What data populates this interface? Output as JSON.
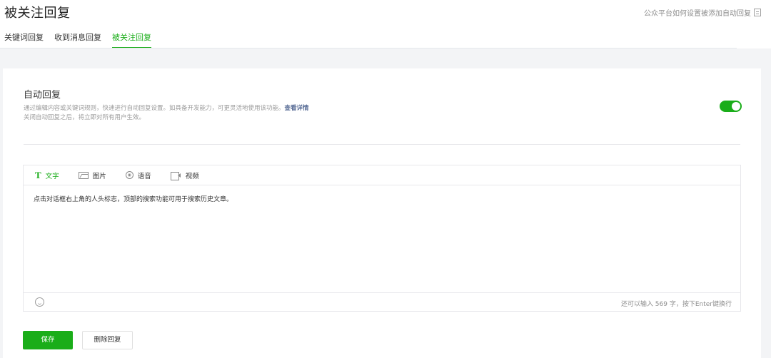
{
  "header": {
    "title": "被关注回复",
    "help_link": "公众平台如何设置被添加自动回复"
  },
  "tabs": [
    {
      "label": "关键词回复",
      "active": false
    },
    {
      "label": "收到消息回复",
      "active": false
    },
    {
      "label": "被关注回复",
      "active": true
    }
  ],
  "auto_reply": {
    "title": "自动回复",
    "desc_line1": "通过编辑内容或关键词规则，快速进行自动回复设置。如具备开发能力，可更灵活地使用该功能。",
    "desc_link": "查看详情",
    "desc_line2": "关闭自动回复之后，将立即对所有用户生效。",
    "enabled": true
  },
  "editor": {
    "tabs": [
      {
        "label": "文字",
        "icon": "text-icon",
        "active": true
      },
      {
        "label": "图片",
        "icon": "image-icon",
        "active": false
      },
      {
        "label": "语音",
        "icon": "voice-icon",
        "active": false
      },
      {
        "label": "视频",
        "icon": "video-icon",
        "active": false
      }
    ],
    "content": "点击对话框右上角的人头标志，顶部的搜索功能可用于搜索历史文章。",
    "char_count": "还可以输入 569 字，按下Enter键换行"
  },
  "actions": {
    "save_label": "保存",
    "delete_label": "删除回复"
  },
  "colors": {
    "accent": "#1aad19",
    "link": "#576b95"
  }
}
